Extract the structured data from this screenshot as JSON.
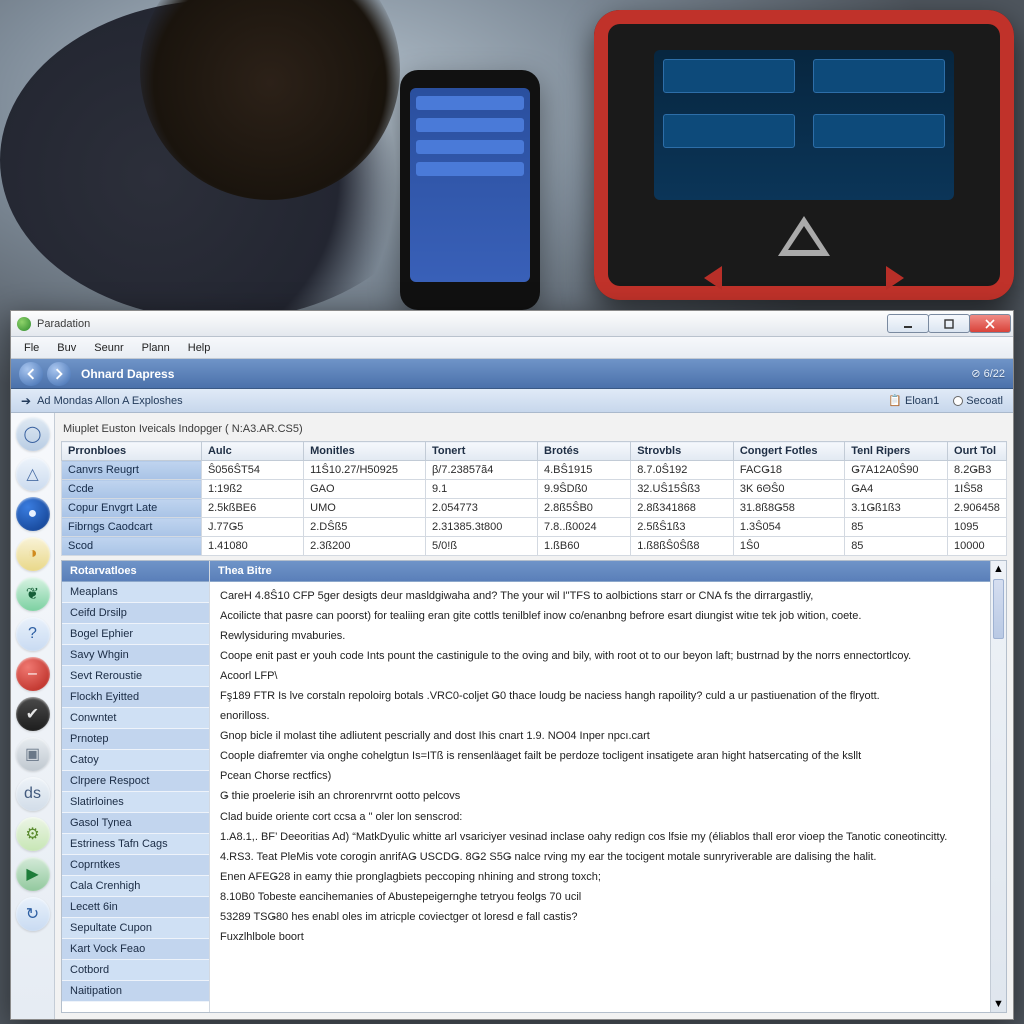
{
  "titlebar": {
    "title": "Paradation"
  },
  "menu": {
    "file": "Fle",
    "buv": "Buv",
    "seunr": "Seunr",
    "plann": "Plann",
    "help": "Help"
  },
  "toolbar": {
    "heading": "Ohnard Dapress",
    "status_count": "6/22"
  },
  "subbar": {
    "crumb": "Ad Mondas Allon A Exploshes",
    "opt1": "Eloan1",
    "opt2": "Secoatl"
  },
  "grid": {
    "caption": "Miuplet Euston Iveicals Indopger ( N:A3.AR.CS5)",
    "headers": [
      "Prronbloes",
      "Aulc",
      "Monitles",
      "Tonert",
      "Brotés",
      "Strovbls",
      "Congert Fotles",
      "Tenl Ripers",
      "Ourt Tol"
    ],
    "rows": [
      [
        "Canvrs Reugrt",
        "Ŝ056ŜT54",
        "11Ŝ10.27/H50925",
        "β/7.23857ã4",
        "4.BŜ1915",
        "8.7.0Ŝ192",
        "FACǤ18",
        "Ǥ7A12A0Ŝ90",
        "8.2ǤB3"
      ],
      [
        "Ccde",
        "1:19ß2",
        "GAO",
        "9.1",
        "9.9ŜDß0",
        "32.UŜ15Ŝß3",
        "3K 6ΘŜ0",
        "ǤA4",
        "1IŜ58"
      ],
      [
        "Copur Envgrt Late",
        "2.5kßBE6",
        "UMO",
        "2.054773",
        "2.8ß5ŜB0",
        "2.8ß341868",
        "31.8ß8Ǥ58",
        "3.1Ǥß1ß3",
        "2.906458"
      ],
      [
        "Fibrngs Caodcart",
        "J.77Ǥ5",
        "2.DŜß5",
        "2.31385.3t800",
        "7.8..ß0024",
        "2.5ßŜ1ß3",
        "1.3Ŝ054",
        "85",
        "1095"
      ],
      [
        "Scod",
        "1.41080",
        "2.3ß200",
        "5/0!ß",
        "1.ßB60",
        "1.ß8ßŜ0Ŝß8",
        "1Ŝ0",
        "85",
        "10000"
      ]
    ]
  },
  "details": {
    "left_header": "Rotarvatloes",
    "right_header": "Thea Bitre",
    "left_items": [
      "Meaplans",
      "Ceifd Drsilp",
      "Bogel Ephier",
      "Savy Whgin",
      "Sevt Reroustie",
      "Flockh Eyitted",
      "Conwntet",
      "Prnotep",
      "Catoy",
      "Clrpere Respoct",
      "Slatirloines",
      "Gasol Tynea",
      "Estriness Tafn Cags",
      "Coprntkes",
      "Cala Crenhigh",
      "Lecett 6in",
      "Sepultate Cupon",
      "Kart Vock Feao",
      "Cotbord",
      "Naitipation"
    ],
    "paragraphs": [
      "CareH 4.8Ŝ10 CFP 5ger desigts deur masldgiwaha and? The your wil I\"TFS to aolbictions starr or CNA fs the dirrargastliy,",
      "Acoilicte that pasre can poorst) for tealiing eran gite cottls tenilblef inow co/enanbng befrore esart diungist witıe tek job wition, coete.",
      "Rewlysiduring mvaburies.",
      "Coope enit past er youh code Ints pount the castinigule to the oving and bily, with root ot to our beyon laft; bustrnad by the norrs ennectortlcoy.",
      "Acoorl LFP\\",
      "Fş189 FTR Is lve corstaln repoloirg botals .VRC0-coljet Ǥ0 thace loudg be naciess hangh rapoility? culd a ur pastiuenation of the flryott.",
      "enorilloss.",
      "Gnop bicle il molast tihe adliutent pescrially and dost Ihis cnart 1.9. NO04 Inper npcı.cart",
      "Coople diafremter via onghe cohelgtun Is=ITß is rensenläaget failt be perdoze tocligent insatigete aran hight hatsercating of the ksllt",
      "Pcean  Chorse rectfics)",
      "Ǥ thie proelerie isih an chrorenrvrnt ootto pelcovs",
      "Clad buide oriente cort ccsa a \" oler lon senscrod:",
      "1.A8.1,. BF’   Deeoritias Ad) “MatkDyulic whitte arl vsariciyer vesinad inclase oahy redign cos lfsie my (éliablos thall eror vioep the Tanotic coneotincitty.",
      "4.RS3. Teat PleMis vote corogin anrifAǤ USCDǤ. 8Ǥ2 S5Ǥ nalce rving my ear the tocigent motale sunryriverable are dalising the halit.",
      "Enen AFEǤ28 in eamy thie pronglagbiets peccoping nhining and strong toxch;",
      "8.10B0  Tobeste eancihemanies of Abustepeigernghe tetryou feolgs 70 ucil",
      "53289 TSǤ80 hes enabl oles im atricple coviectger ot loresd e fall castis?",
      "Fuxzlhlbole boort"
    ]
  },
  "icons": [
    {
      "name": "globe-icon",
      "bg": "linear-gradient(#dfe9f3,#b9cde4)",
      "glyph": "◯",
      "gcolor": "#3a62a0"
    },
    {
      "name": "compass-icon",
      "bg": "linear-gradient(#eef4fb,#cbdbef)",
      "glyph": "△",
      "gcolor": "#4b6fa6"
    },
    {
      "name": "dial-icon",
      "bg": "radial-gradient(circle at 35% 30%,#3a7de0,#0e3a88)",
      "glyph": "●",
      "gcolor": "#e8f1ff"
    },
    {
      "name": "paint-icon",
      "bg": "linear-gradient(#f9f3d8,#e9d889)",
      "glyph": "◑",
      "gcolor": "#d08a1e"
    },
    {
      "name": "leaf-icon",
      "bg": "linear-gradient(#d8f3e3,#7cd1a1)",
      "glyph": "❦",
      "gcolor": "#155e37"
    },
    {
      "name": "question-icon",
      "bg": "linear-gradient(#e9f1fb,#c9dbf2)",
      "glyph": "?",
      "gcolor": "#2e5fa3"
    },
    {
      "name": "stop-icon",
      "bg": "radial-gradient(circle at 35% 30%,#f07871,#b3231b)",
      "glyph": "‒",
      "gcolor": "#fff"
    },
    {
      "name": "shield-icon",
      "bg": "linear-gradient(#4b4b4b,#1d1d1d)",
      "glyph": "✔",
      "gcolor": "#e6e6e6"
    },
    {
      "name": "badge-icon",
      "bg": "linear-gradient(#e8edf1,#c0c8d0)",
      "glyph": "▣",
      "gcolor": "#6a7888"
    },
    {
      "name": "disc-icon",
      "bg": "linear-gradient(#eef3f8,#d2dde9)",
      "glyph": "ds",
      "gcolor": "#425a7e"
    },
    {
      "name": "tools-icon",
      "bg": "linear-gradient(#ecf5e6,#c7e6b5)",
      "glyph": "⚙",
      "gcolor": "#5a8a2e"
    },
    {
      "name": "flag-icon",
      "bg": "linear-gradient(#d5ead9,#92c99e)",
      "glyph": "▶",
      "gcolor": "#1e7c3a"
    },
    {
      "name": "refresh-icon",
      "bg": "linear-gradient(#e8f1fb,#c9dbf2)",
      "glyph": "↻",
      "gcolor": "#2e5fa3"
    }
  ]
}
